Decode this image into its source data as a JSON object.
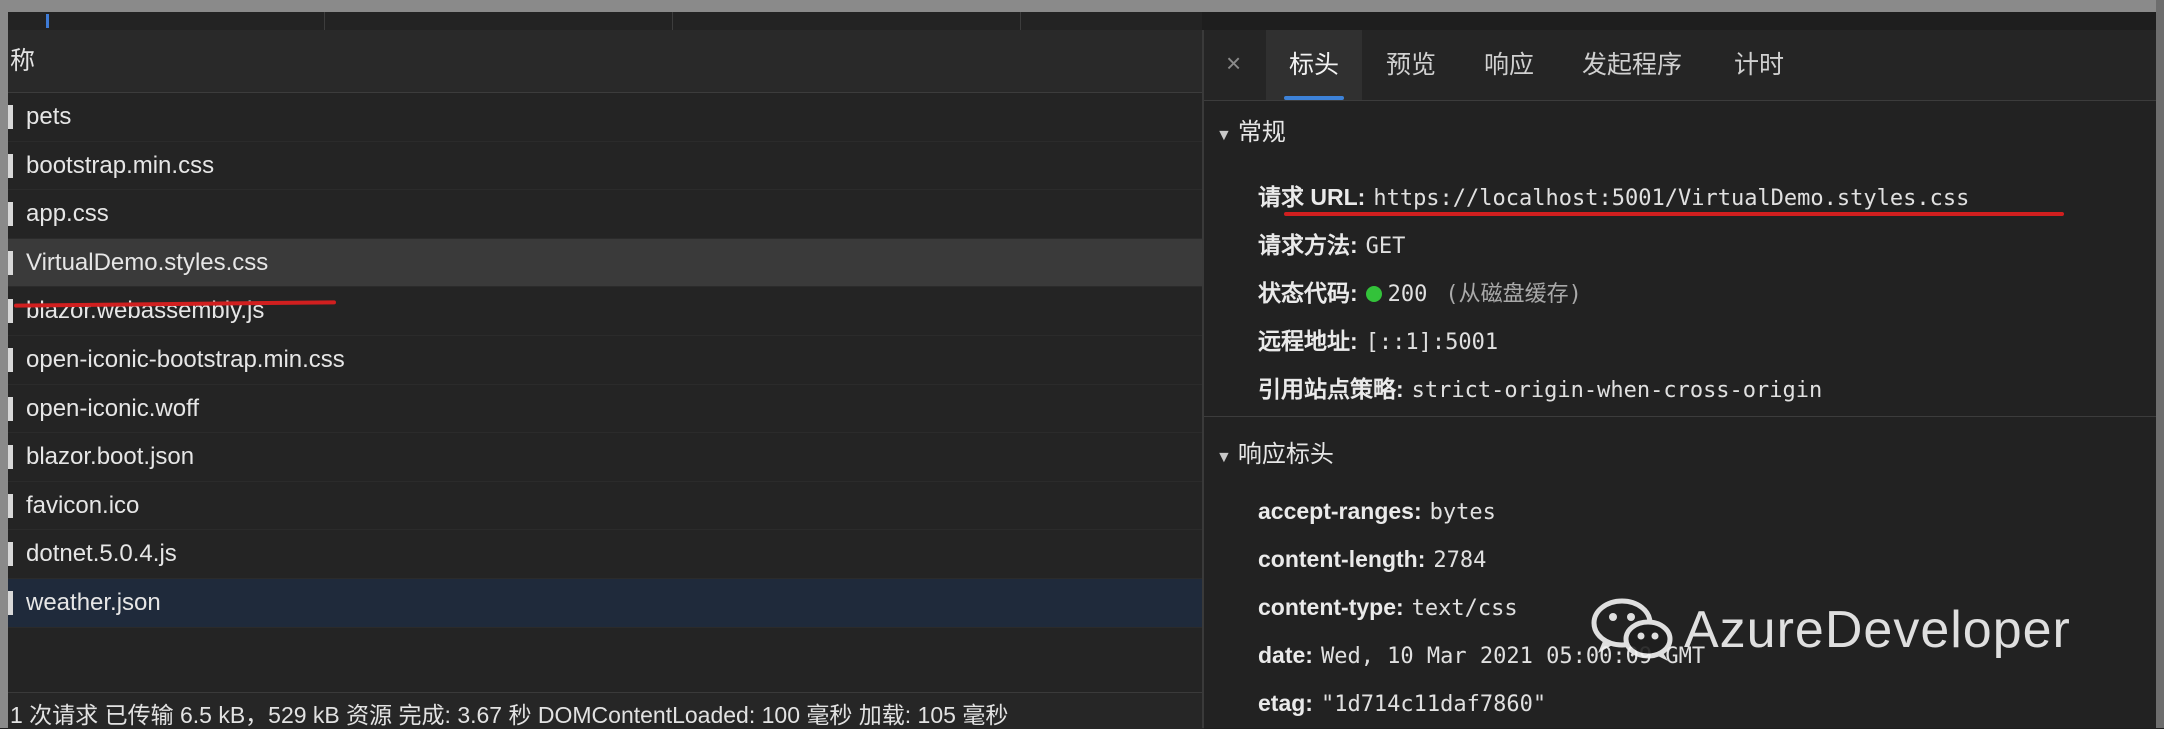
{
  "left": {
    "column_header": "称",
    "requests": [
      {
        "name": "pets",
        "state": "normal"
      },
      {
        "name": "bootstrap.min.css",
        "state": "normal"
      },
      {
        "name": "app.css",
        "state": "normal"
      },
      {
        "name": "VirtualDemo.styles.css",
        "state": "selected"
      },
      {
        "name": "blazor.webassembly.js",
        "state": "normal"
      },
      {
        "name": "open-iconic-bootstrap.min.css",
        "state": "normal"
      },
      {
        "name": "open-iconic.woff",
        "state": "normal"
      },
      {
        "name": "blazor.boot.json",
        "state": "normal"
      },
      {
        "name": "favicon.ico",
        "state": "normal"
      },
      {
        "name": "dotnet.5.0.4.js",
        "state": "normal"
      },
      {
        "name": "weather.json",
        "state": "active"
      }
    ],
    "status_bar": "1 次请求  已传输 6.5 kB，529 kB 资源  完成: 3.67 秒  DOMContentLoaded: 100 毫秒  加载: 105 毫秒"
  },
  "right": {
    "close_icon": "×",
    "tabs": [
      "标头",
      "预览",
      "响应",
      "发起程序",
      "计时"
    ],
    "active_tab": "标头",
    "general": {
      "title": "常规",
      "request_url_label": "请求 URL:",
      "request_url": "https://localhost:5001/VirtualDemo.styles.css",
      "method_label": "请求方法:",
      "method": "GET",
      "status_label": "状态代码:",
      "status_code": "200",
      "status_note": "(从磁盘缓存)",
      "status_color": "#33c23a",
      "remote_label": "远程地址:",
      "remote": "[::1]:5001",
      "referrer_label": "引用站点策略:",
      "referrer": "strict-origin-when-cross-origin"
    },
    "response_headers": {
      "title": "响应标头",
      "items": [
        {
          "key": "accept-ranges:",
          "value": "bytes"
        },
        {
          "key": "content-length:",
          "value": "2784"
        },
        {
          "key": "content-type:",
          "value": "text/css"
        },
        {
          "key": "date:",
          "value": "Wed, 10 Mar 2021 05:00:09 GMT"
        },
        {
          "key": "etag:",
          "value": "\"1d714c11daf7860\""
        }
      ]
    }
  },
  "watermark": {
    "text": "AzureDeveloper",
    "icon": "wechat-icon"
  },
  "colors": {
    "accent": "#3d82d8",
    "annotation": "#d11f1f",
    "selected_row": "#3a3a3a",
    "active_row": "#1f2a3b"
  }
}
